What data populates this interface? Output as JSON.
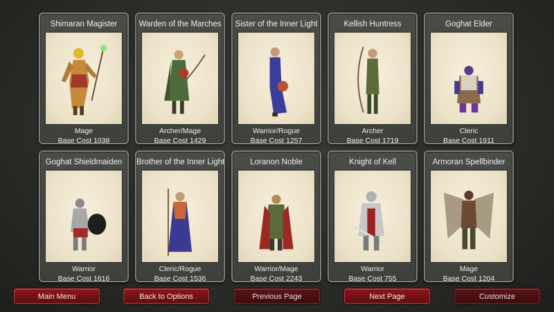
{
  "cards": [
    {
      "name": "Shimaran Magister",
      "class": "Mage",
      "cost": "Base Cost 1038",
      "icon": "mage-figure-icon"
    },
    {
      "name": "Warden of the Marches",
      "class": "Archer/Mage",
      "cost": "Base Cost 1429",
      "icon": "archer-figure-icon"
    },
    {
      "name": "Sister of the Inner Light",
      "class": "Warrior/Rogue",
      "cost": "Base Cost 1257",
      "icon": "robed-figure-icon"
    },
    {
      "name": "Kellish Huntress",
      "class": "Archer",
      "cost": "Base Cost 1719",
      "icon": "archer-figure-icon"
    },
    {
      "name": "Goghat Elder",
      "class": "Cleric",
      "cost": "Base Cost 1911",
      "icon": "dwarf-figure-icon"
    },
    {
      "name": "Goghat Shieldmaiden",
      "class": "Warrior",
      "cost": "Base Cost 1616",
      "icon": "shield-warrior-icon"
    },
    {
      "name": "Brother of the Inner Light",
      "class": "Cleric/Rogue",
      "cost": "Base Cost 1536",
      "icon": "robed-figure-icon"
    },
    {
      "name": "Loranon Noble",
      "class": "Warrior/Mage",
      "cost": "Base Cost 2243",
      "icon": "noble-figure-icon"
    },
    {
      "name": "Knight of Kell",
      "class": "Warrior",
      "cost": "Base Cost 755",
      "icon": "knight-figure-icon"
    },
    {
      "name": "Armoran Spellbinder",
      "class": "Mage",
      "cost": "Base Cost 1204",
      "icon": "winged-figure-icon"
    }
  ],
  "buttons": {
    "main_menu": "Main Menu",
    "back_to_options": "Back to Options",
    "previous_page": "Previous Page",
    "next_page": "Next Page",
    "customize": "Customize"
  },
  "colors": {
    "button_red": "#8e1518",
    "card_border": "#7c7e78",
    "portrait_bg": "#f2ead4"
  }
}
